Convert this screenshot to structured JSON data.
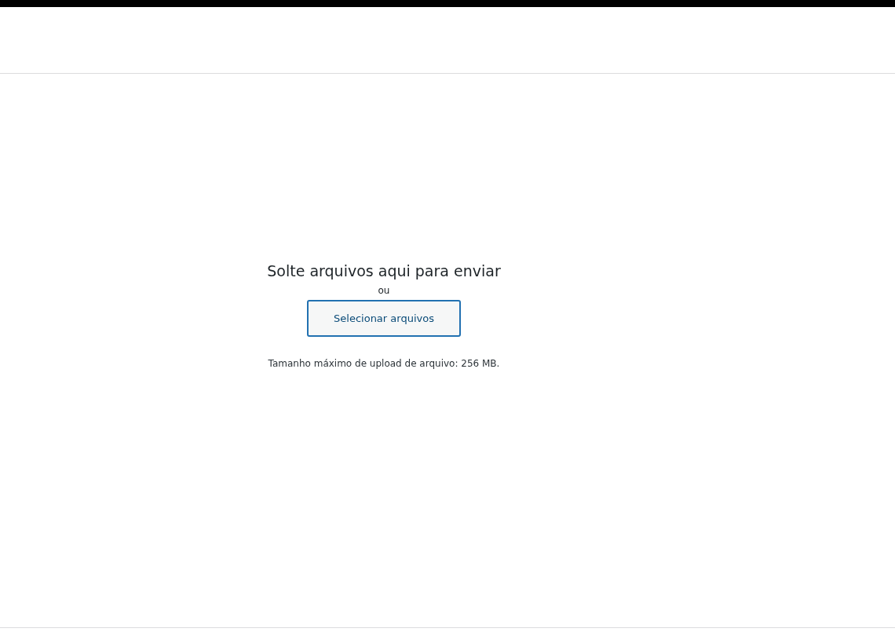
{
  "uploader": {
    "drop_title": "Solte arquivos aqui para enviar",
    "separator": "ou",
    "select_button": "Selecionar arquivos",
    "max_size_note": "Tamanho máximo de upload de arquivo: 256 MB."
  }
}
